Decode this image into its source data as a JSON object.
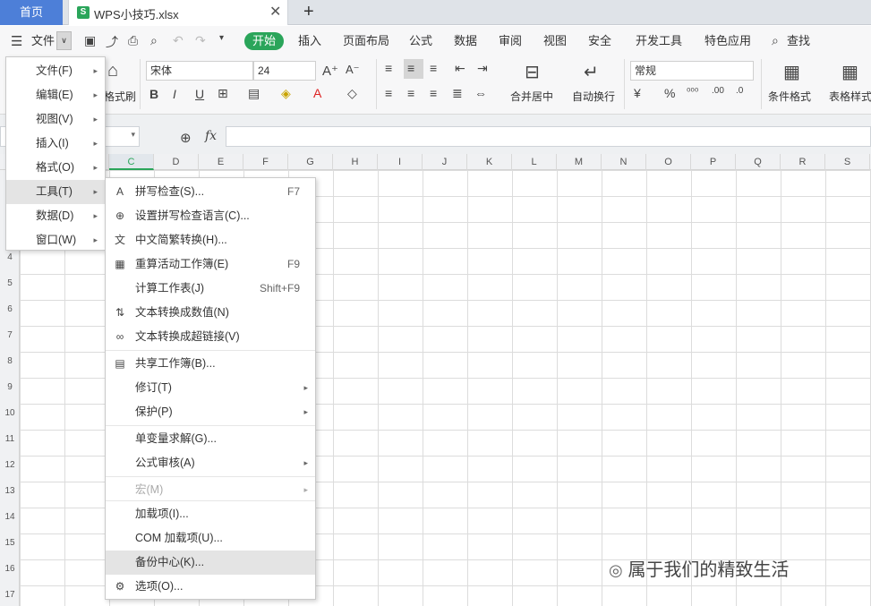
{
  "tabs": {
    "home": "首页",
    "file": "WPS小技巧.xlsx",
    "new": "+"
  },
  "menubar": {
    "menu_label": "文件",
    "items": [
      "开始",
      "插入",
      "页面布局",
      "公式",
      "数据",
      "审阅",
      "视图",
      "安全",
      "开发工具",
      "特色应用"
    ],
    "search": "查找"
  },
  "ribbon": {
    "format_painter": "格式刷",
    "font_name": "宋体",
    "font_size": "24",
    "number_format": "常规",
    "merge_center": "合并居中",
    "wrap_text": "自动换行",
    "conditional_format": "条件格式",
    "table_style": "表格样式"
  },
  "formula_bar": {
    "fx": "fx",
    "value": ""
  },
  "columns": [
    "C",
    "D",
    "E",
    "F",
    "G",
    "H",
    "I",
    "J",
    "K",
    "L",
    "M",
    "N",
    "O",
    "P",
    "Q",
    "R",
    "S"
  ],
  "rows": [
    "4",
    "5",
    "6",
    "7",
    "8",
    "9",
    "10",
    "11",
    "12",
    "13",
    "14",
    "15",
    "16",
    "17"
  ],
  "main_menu": [
    {
      "label": "文件(F)"
    },
    {
      "label": "编辑(E)"
    },
    {
      "label": "视图(V)"
    },
    {
      "label": "插入(I)"
    },
    {
      "label": "格式(O)"
    },
    {
      "label": "工具(T)"
    },
    {
      "label": "数据(D)"
    },
    {
      "label": "窗口(W)"
    }
  ],
  "tools_menu": [
    {
      "label": "拼写检查(S)...",
      "key": "F7"
    },
    {
      "label": "设置拼写检查语言(C)...",
      "key": ""
    },
    {
      "label": "中文简繁转换(H)...",
      "key": ""
    },
    {
      "label": "重算活动工作簿(E)",
      "key": "F9"
    },
    {
      "label": "计算工作表(J)",
      "key": "Shift+F9"
    },
    {
      "label": "文本转换成数值(N)",
      "key": ""
    },
    {
      "label": "文本转换成超链接(V)",
      "key": ""
    },
    {
      "label": "共享工作簿(B)...",
      "key": ""
    },
    {
      "label": "修订(T)",
      "key": ""
    },
    {
      "label": "保护(P)",
      "key": ""
    },
    {
      "label": "单变量求解(G)...",
      "key": ""
    },
    {
      "label": "公式审核(A)",
      "key": ""
    },
    {
      "label": "宏(M)",
      "key": ""
    },
    {
      "label": "加载项(I)...",
      "key": ""
    },
    {
      "label": "COM 加载项(U)...",
      "key": ""
    },
    {
      "label": "备份中心(K)...",
      "key": ""
    },
    {
      "label": "选项(O)...",
      "key": ""
    }
  ],
  "watermark": "属于我们的精致生活",
  "colors": {
    "accent_green": "#2aa55a",
    "home_tab": "#4d7fd8"
  }
}
